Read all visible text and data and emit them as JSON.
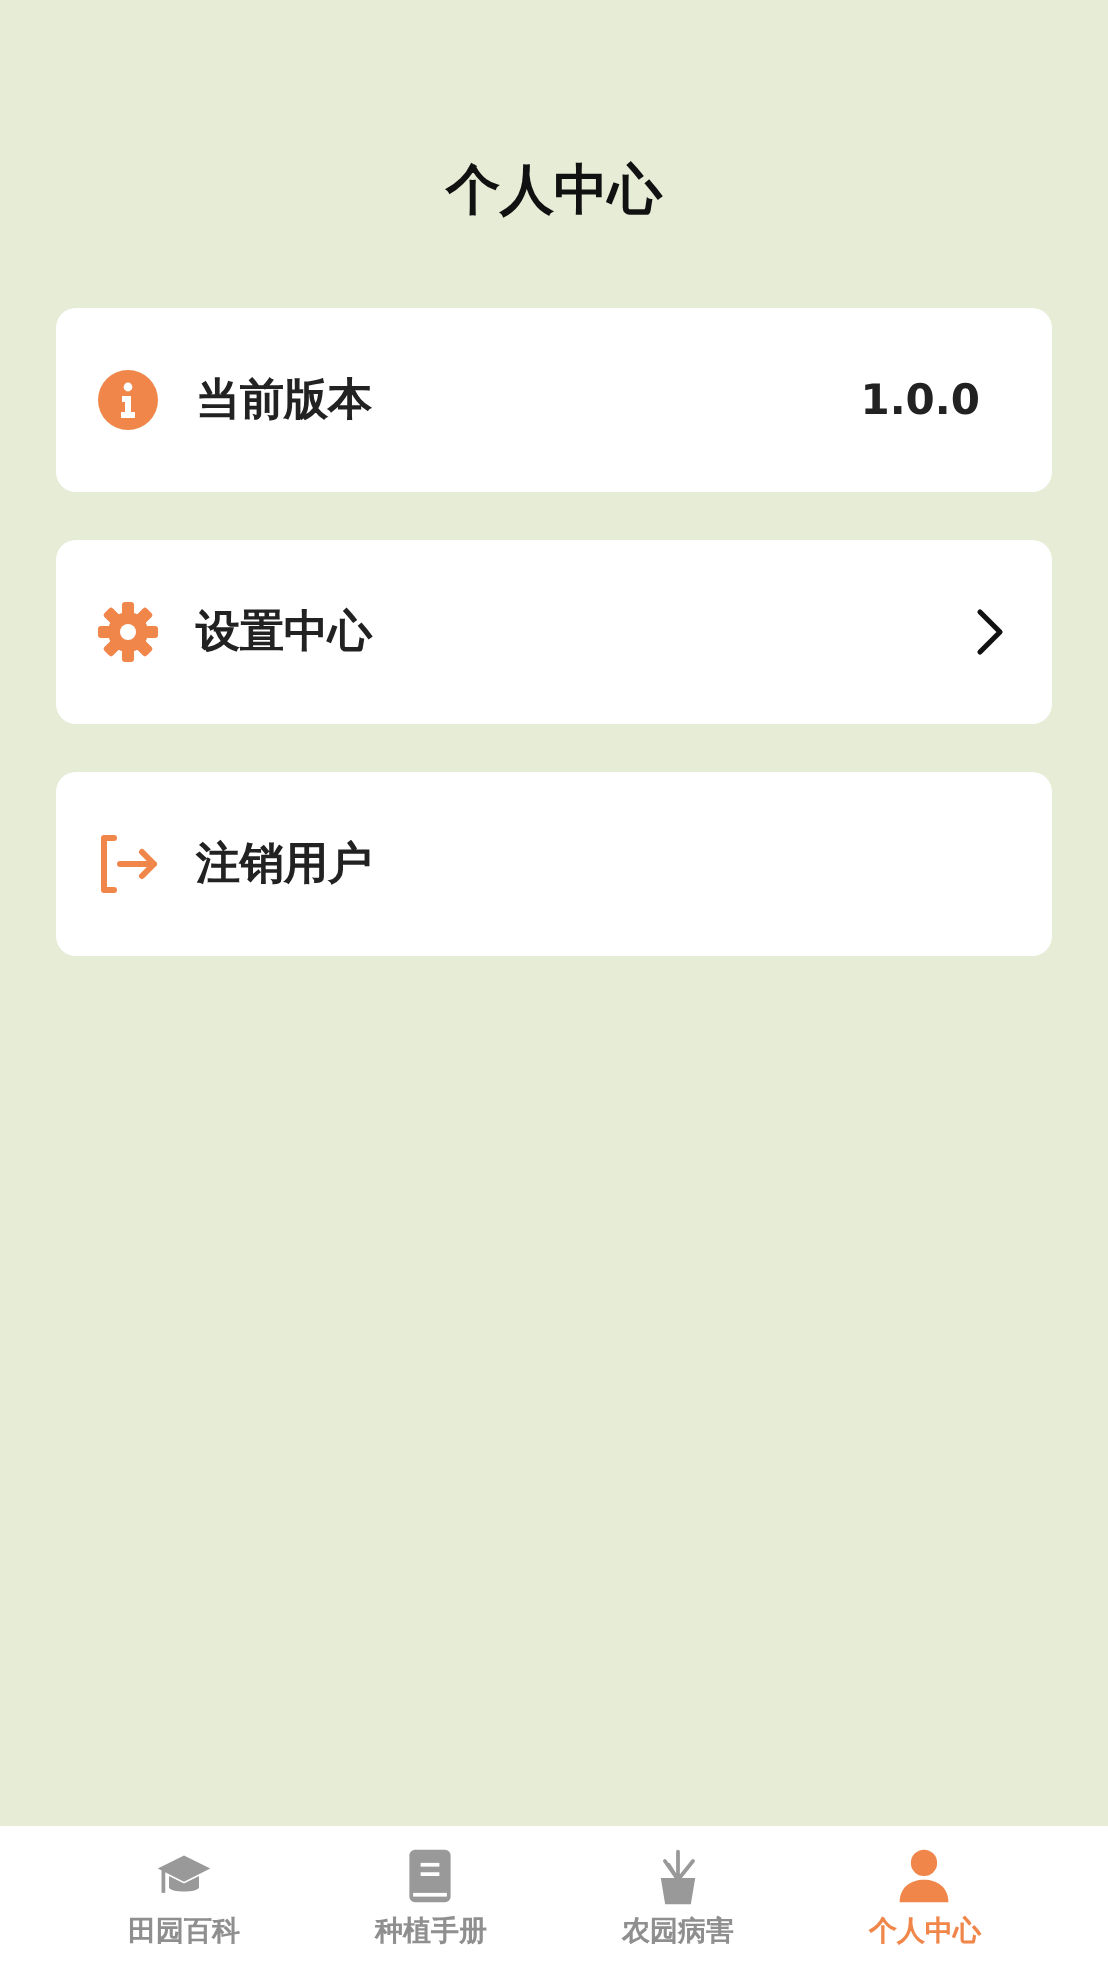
{
  "header": {
    "title": "个人中心"
  },
  "menu": [
    {
      "kind": "info",
      "label": "当前版本",
      "value": "1.0.0"
    },
    {
      "kind": "settings",
      "label": "设置中心",
      "chevron": true
    },
    {
      "kind": "logout",
      "label": "注销用户"
    }
  ],
  "tabs": [
    {
      "kind": "cap",
      "label": "田园百科",
      "selected": false
    },
    {
      "kind": "book",
      "label": "种植手册",
      "selected": false
    },
    {
      "kind": "plant",
      "label": "农园病害",
      "selected": false
    },
    {
      "kind": "person",
      "label": "个人中心",
      "selected": true
    }
  ]
}
